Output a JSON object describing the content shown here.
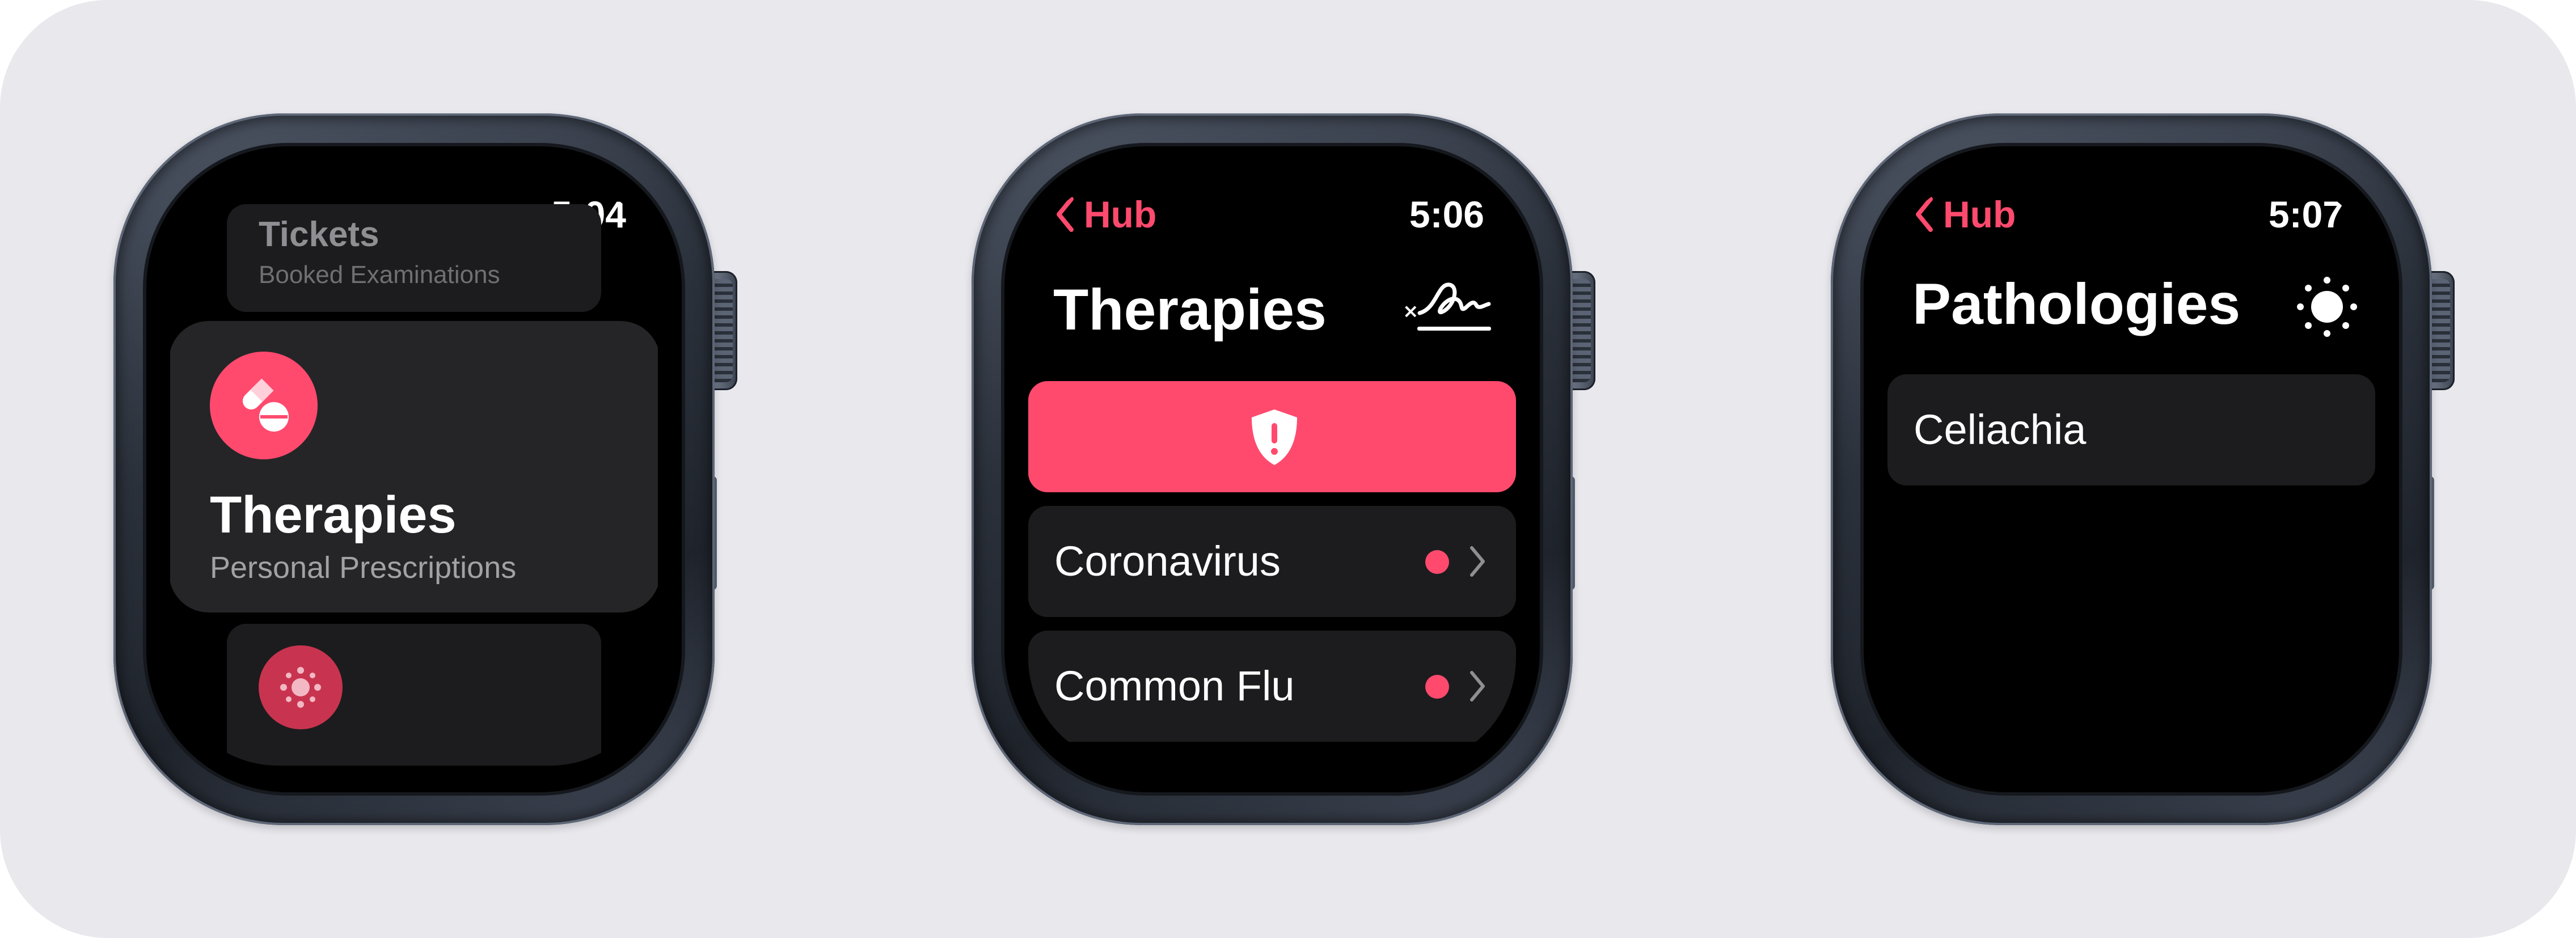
{
  "colors": {
    "accent": "#ff4a6e",
    "background": "#e8e8ed",
    "card": "#1c1c1e"
  },
  "watch1": {
    "time": "5:04",
    "tickets": {
      "title": "Tickets",
      "subtitle": "Booked Examinations"
    },
    "therapies": {
      "icon": "pills-icon",
      "title": "Therapies",
      "subtitle": "Personal Prescriptions"
    },
    "next_item": {
      "icon": "virus-icon"
    }
  },
  "watch2": {
    "back_label": "Hub",
    "time": "5:06",
    "title": "Therapies",
    "header_icon": "signature-icon",
    "alert_icon": "shield-exclamation-icon",
    "items": [
      {
        "label": "Coronavirus",
        "indicator": "red-dot"
      },
      {
        "label": "Common Flu",
        "indicator": "red-dot"
      }
    ]
  },
  "watch3": {
    "back_label": "Hub",
    "time": "5:07",
    "title": "Pathologies",
    "header_icon": "sun-icon",
    "items": [
      {
        "label": "Celiachia"
      }
    ]
  }
}
